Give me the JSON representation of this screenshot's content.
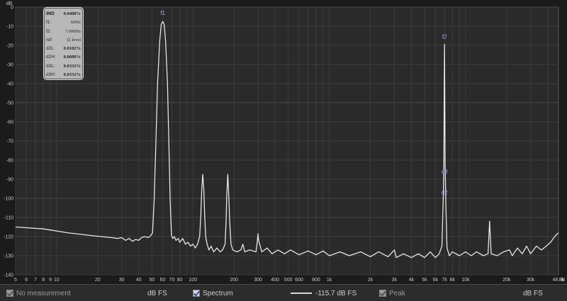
{
  "chart_data": {
    "type": "line",
    "xscale": "log",
    "xlim": [
      5,
      48000
    ],
    "ylim": [
      -140,
      0
    ],
    "grid": true,
    "ylabel": "dB",
    "xlabel": "Hz",
    "yticks": [
      0,
      -10,
      -20,
      -30,
      -40,
      -50,
      -60,
      -70,
      -80,
      -90,
      -100,
      -110,
      -120,
      -130,
      -140
    ],
    "xticks": [
      {
        "v": 5,
        "t": "5"
      },
      {
        "v": 6,
        "t": "6"
      },
      {
        "v": 7,
        "t": "7"
      },
      {
        "v": 8,
        "t": "8"
      },
      {
        "v": 9,
        "t": "9"
      },
      {
        "v": 10,
        "t": "10"
      },
      {
        "v": 20,
        "t": "20"
      },
      {
        "v": 30,
        "t": "30"
      },
      {
        "v": 40,
        "t": "40"
      },
      {
        "v": 50,
        "t": "50"
      },
      {
        "v": 60,
        "t": "60"
      },
      {
        "v": 70,
        "t": "70"
      },
      {
        "v": 80,
        "t": "80"
      },
      {
        "v": 100,
        "t": "100"
      },
      {
        "v": 200,
        "t": "200"
      },
      {
        "v": 300,
        "t": "300"
      },
      {
        "v": 400,
        "t": "400"
      },
      {
        "v": 500,
        "t": "500"
      },
      {
        "v": 600,
        "t": "600"
      },
      {
        "v": 800,
        "t": "800"
      },
      {
        "v": 1000,
        "t": "1k"
      },
      {
        "v": 2000,
        "t": "2k"
      },
      {
        "v": 3000,
        "t": "3k"
      },
      {
        "v": 4000,
        "t": "4k"
      },
      {
        "v": 5000,
        "t": "5k"
      },
      {
        "v": 6000,
        "t": "6k"
      },
      {
        "v": 7000,
        "t": "7k"
      },
      {
        "v": 8000,
        "t": "8k"
      },
      {
        "v": 10000,
        "t": "10k"
      },
      {
        "v": 20000,
        "t": "20k"
      },
      {
        "v": 30000,
        "t": "30k"
      },
      {
        "v": 48000,
        "t": "48.0k"
      }
    ],
    "series": [
      {
        "values": [
          [
            5,
            -115
          ],
          [
            8,
            -116
          ],
          [
            12,
            -118
          ],
          [
            18,
            -119.5
          ],
          [
            25,
            -120.5
          ],
          [
            28,
            -121
          ],
          [
            30,
            -120.5
          ],
          [
            32,
            -122
          ],
          [
            34,
            -121
          ],
          [
            36,
            -122.5
          ],
          [
            38,
            -121.5
          ],
          [
            40,
            -122
          ],
          [
            42,
            -120.5
          ],
          [
            44,
            -120
          ],
          [
            47,
            -120.5
          ],
          [
            49,
            -119.5
          ],
          [
            50.5,
            -118
          ],
          [
            52,
            -100
          ],
          [
            53.5,
            -70
          ],
          [
            55,
            -40
          ],
          [
            57,
            -18
          ],
          [
            58.5,
            -9
          ],
          [
            60,
            -7.5
          ],
          [
            61.5,
            -9
          ],
          [
            63,
            -18
          ],
          [
            65,
            -40
          ],
          [
            66.5,
            -70
          ],
          [
            68,
            -100
          ],
          [
            69.5,
            -119
          ],
          [
            71,
            -121
          ],
          [
            73,
            -120
          ],
          [
            75,
            -122
          ],
          [
            78,
            -121
          ],
          [
            80,
            -123
          ],
          [
            84,
            -121
          ],
          [
            88,
            -124
          ],
          [
            92,
            -123
          ],
          [
            96,
            -125
          ],
          [
            100,
            -124
          ],
          [
            104,
            -126
          ],
          [
            108,
            -124
          ],
          [
            112,
            -120
          ],
          [
            114,
            -110
          ],
          [
            116,
            -95
          ],
          [
            118,
            -87.5
          ],
          [
            120,
            -95
          ],
          [
            122,
            -110
          ],
          [
            124,
            -120
          ],
          [
            127,
            -124
          ],
          [
            131,
            -127
          ],
          [
            136,
            -125
          ],
          [
            142,
            -128
          ],
          [
            150,
            -126
          ],
          [
            158,
            -128
          ],
          [
            165,
            -127
          ],
          [
            172,
            -124
          ],
          [
            175,
            -112
          ],
          [
            177,
            -98
          ],
          [
            180,
            -87.5
          ],
          [
            183,
            -98
          ],
          [
            186,
            -112
          ],
          [
            190,
            -124
          ],
          [
            196,
            -127
          ],
          [
            210,
            -128
          ],
          [
            225,
            -127
          ],
          [
            232,
            -124
          ],
          [
            240,
            -128
          ],
          [
            260,
            -127
          ],
          [
            290,
            -128
          ],
          [
            297,
            -122
          ],
          [
            300,
            -118.5
          ],
          [
            303,
            -122
          ],
          [
            320,
            -128
          ],
          [
            350,
            -126
          ],
          [
            380,
            -129
          ],
          [
            420,
            -127
          ],
          [
            470,
            -129
          ],
          [
            520,
            -127
          ],
          [
            600,
            -129.5
          ],
          [
            700,
            -127.5
          ],
          [
            800,
            -129.5
          ],
          [
            900,
            -127.5
          ],
          [
            1000,
            -130
          ],
          [
            1200,
            -128
          ],
          [
            1400,
            -130
          ],
          [
            1700,
            -128
          ],
          [
            2000,
            -130.5
          ],
          [
            2300,
            -128
          ],
          [
            2700,
            -130.5
          ],
          [
            3000,
            -127
          ],
          [
            3100,
            -131
          ],
          [
            3500,
            -129
          ],
          [
            4000,
            -131
          ],
          [
            4500,
            -129
          ],
          [
            5000,
            -131
          ],
          [
            5500,
            -128
          ],
          [
            6000,
            -131
          ],
          [
            6400,
            -129
          ],
          [
            6700,
            -125
          ],
          [
            6850,
            -100
          ],
          [
            6930,
            -80
          ],
          [
            6970,
            -40
          ],
          [
            7000,
            -19.5
          ],
          [
            7030,
            -40
          ],
          [
            7070,
            -80
          ],
          [
            7150,
            -100
          ],
          [
            7300,
            -126
          ],
          [
            7600,
            -130
          ],
          [
            8000,
            -128
          ],
          [
            9000,
            -130
          ],
          [
            10000,
            -128
          ],
          [
            11000,
            -130
          ],
          [
            12000,
            -128
          ],
          [
            13500,
            -130
          ],
          [
            14600,
            -129
          ],
          [
            15000,
            -112
          ],
          [
            15400,
            -129
          ],
          [
            17000,
            -130
          ],
          [
            19000,
            -128
          ],
          [
            21000,
            -127
          ],
          [
            22000,
            -130
          ],
          [
            24000,
            -126
          ],
          [
            26000,
            -129
          ],
          [
            28000,
            -125
          ],
          [
            30000,
            -129
          ],
          [
            33000,
            -125
          ],
          [
            36000,
            -127
          ],
          [
            39000,
            -125
          ],
          [
            42000,
            -123
          ],
          [
            45000,
            -120
          ],
          [
            48000,
            -118
          ]
        ]
      }
    ],
    "annotations": [
      {
        "text": "f1",
        "x": 60,
        "y": -4
      },
      {
        "text": "f2",
        "x": 7000,
        "y": -16.5
      },
      {
        "text": "d3",
        "x": 7000,
        "y": -87
      },
      {
        "text": "d2",
        "x": 7000,
        "y": -98
      }
    ]
  },
  "imd_box": {
    "rows": [
      {
        "key": "IMD",
        "value": "0.0488%"
      },
      {
        "key": "f1:",
        "value": "60Hz"
      },
      {
        "key": "f2:",
        "value": "7.000Hz"
      },
      {
        "key": "ref:",
        "value": "f2 level"
      },
      {
        "key": "d2L:",
        "value": "0.0102%"
      },
      {
        "key": "d2H:",
        "value": "0.0088%"
      },
      {
        "key": "d3L:",
        "value": "0.0332%"
      },
      {
        "key": "d3H:",
        "value": "0.0332%"
      }
    ]
  },
  "footer": {
    "no_measurement": "No measurement",
    "unit1": "dB FS",
    "spectrum": "Spectrum",
    "level": "-115.7 dB FS",
    "peak": "Peak",
    "unit2": "dB FS"
  }
}
